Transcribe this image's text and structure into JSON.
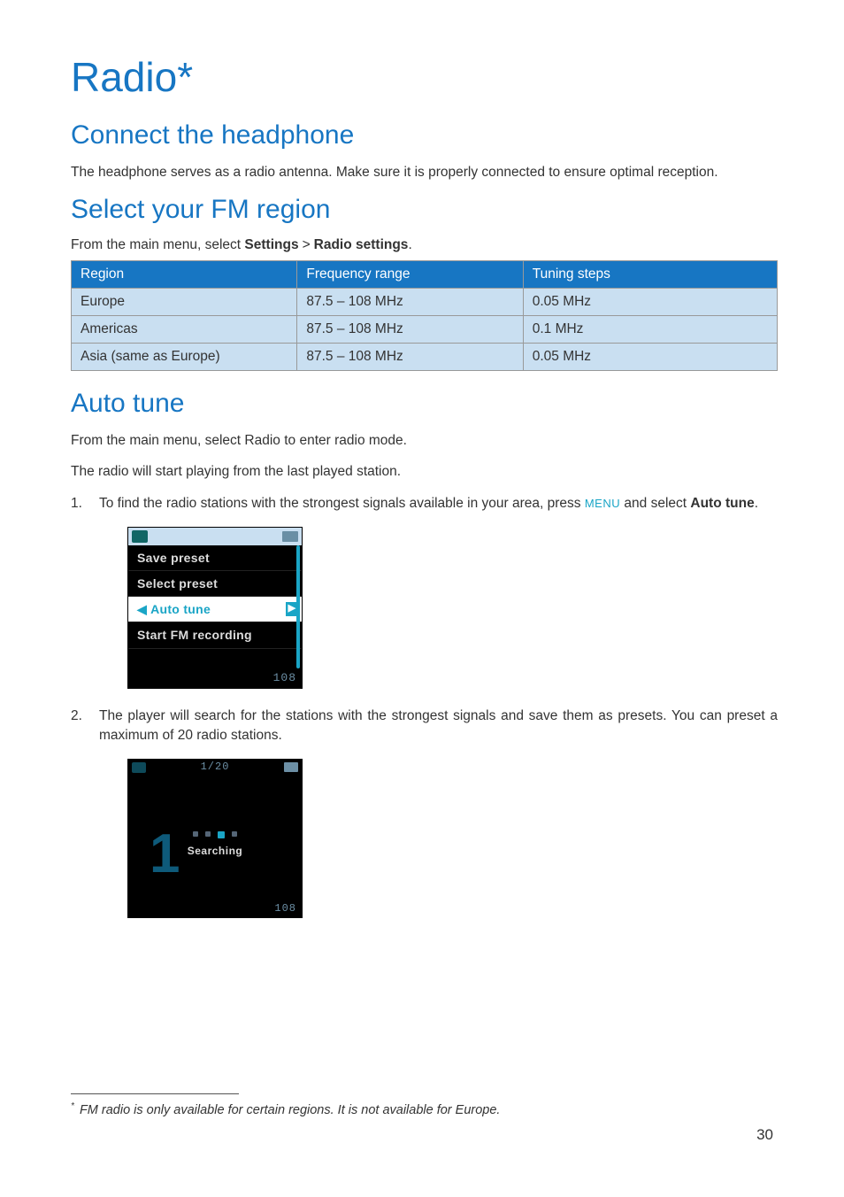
{
  "title": "Radio*",
  "sections": {
    "connect": {
      "heading": "Connect the headphone",
      "body": "The headphone serves as a radio antenna. Make sure it is properly connected to ensure optimal reception."
    },
    "select_region": {
      "heading": "Select your FM region",
      "nav_prefix": "From the main menu, select ",
      "nav_settings": "Settings",
      "nav_gt": ">",
      "nav_radio_settings": "Radio settings",
      "nav_suffix": ".",
      "table": {
        "headers": {
          "region": "Region",
          "freq": "Frequency range",
          "tuning": "Tuning steps"
        },
        "rows": [
          {
            "region": "Europe",
            "freq": "87.5 – 108 MHz",
            "tuning": "0.05 MHz"
          },
          {
            "region": "Americas",
            "freq": "87.5 – 108 MHz",
            "tuning": "0.1 MHz"
          },
          {
            "region": "Asia (same as Europe)",
            "freq": "87.5 – 108 MHz",
            "tuning": "0.05 MHz"
          }
        ]
      }
    },
    "auto_tune": {
      "heading": "Auto tune",
      "intro1a": "From the main menu, select ",
      "intro1b": "Radio",
      "intro1c": " to enter radio mode.",
      "intro2": "The radio will start playing from the last played station.",
      "step1a": "To find the radio stations with the strongest signals available in your area, press ",
      "step1_menu": "MENU",
      "step1b": " and select ",
      "step1_auto": "Auto tune",
      "step1c": ".",
      "step2": "The player will search for the stations with the strongest signals and save them as presets. You can preset a maximum of 20 radio stations."
    }
  },
  "screenshot1": {
    "items": [
      "Save preset",
      "Select preset",
      "Auto tune",
      "Start FM recording"
    ],
    "footer": "108"
  },
  "screenshot2": {
    "status_center": "1/20",
    "big_num": "1",
    "searching": "Searching",
    "footer": "108"
  },
  "footnote": "FM radio is only available for certain regions. It is not available for Europe.",
  "footnote_marker": "*",
  "page_number": "30",
  "chart_data": {
    "type": "table",
    "title": "FM region settings",
    "columns": [
      "Region",
      "Frequency range",
      "Tuning steps"
    ],
    "rows": [
      [
        "Europe",
        "87.5 – 108 MHz",
        "0.05 MHz"
      ],
      [
        "Americas",
        "87.5 – 108 MHz",
        "0.1 MHz"
      ],
      [
        "Asia (same as Europe)",
        "87.5 – 108 MHz",
        "0.05 MHz"
      ]
    ]
  }
}
